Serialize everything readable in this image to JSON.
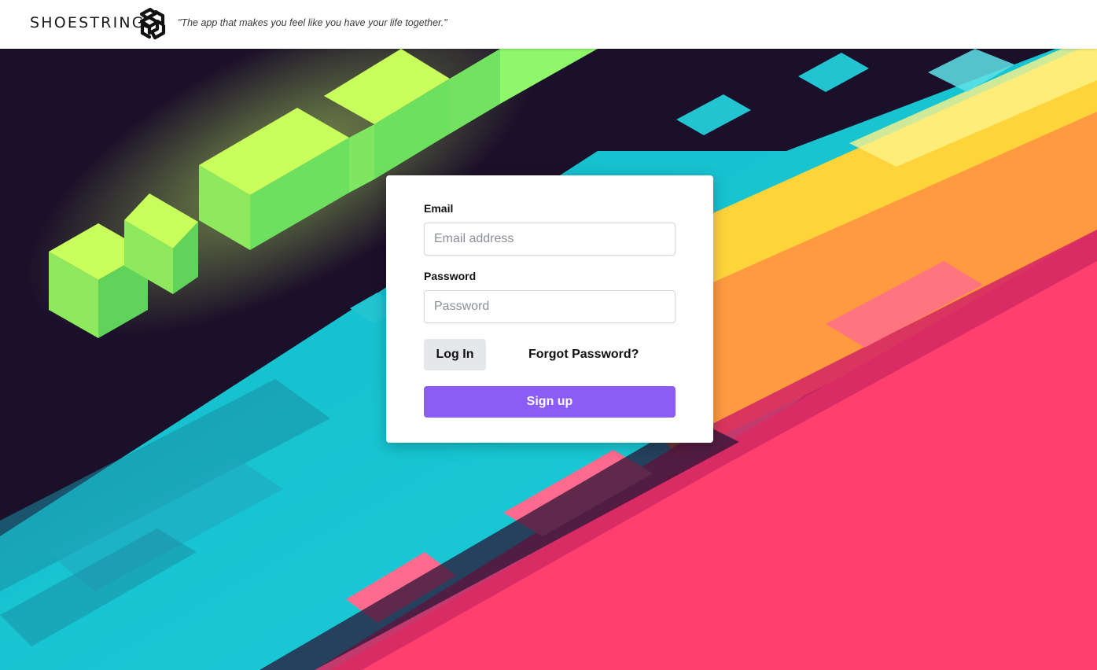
{
  "header": {
    "brand_name": "SHOESTRING",
    "logo_icon": "shoestring-logo-icon",
    "tagline": "\"The app that makes you feel like you have your life together.\""
  },
  "hero": {
    "background_icon": "isometric-cubes-background",
    "colors": {
      "dark": "#1b1029",
      "green": "#bff35a",
      "teal": "#1ac8d4",
      "yellow": "#ffd43b",
      "orange": "#ff9640",
      "pink": "#ff3f6e"
    }
  },
  "login_form": {
    "email_label": "Email",
    "email_placeholder": "Email address",
    "email_value": "",
    "password_label": "Password",
    "password_placeholder": "Password",
    "password_value": "",
    "login_button": "Log In",
    "forgot_link": "Forgot Password?",
    "signup_button": "Sign up",
    "colors": {
      "signup_bg": "#8b5cf6",
      "login_bg": "#e5e7eb"
    }
  }
}
